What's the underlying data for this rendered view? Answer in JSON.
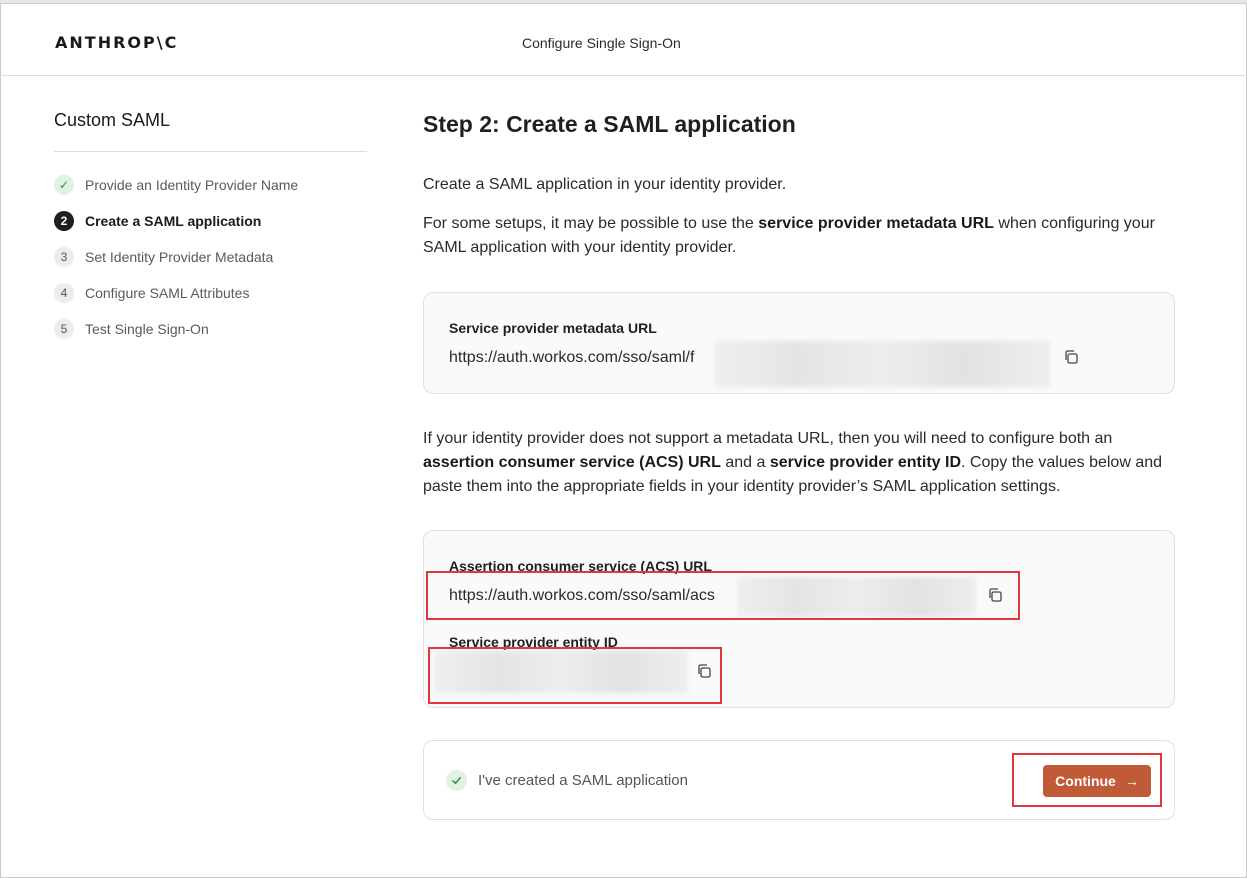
{
  "app": {
    "logo_text": "ANTHROP\\C",
    "header_title": "Configure Single Sign-On"
  },
  "sidebar": {
    "title": "Custom SAML",
    "steps": [
      {
        "badge": "✓",
        "label": "Provide an Identity Provider Name",
        "state": "done"
      },
      {
        "badge": "2",
        "label": "Create a SAML application",
        "state": "active"
      },
      {
        "badge": "3",
        "label": "Set Identity Provider Metadata",
        "state": "todo"
      },
      {
        "badge": "4",
        "label": "Configure SAML Attributes",
        "state": "todo"
      },
      {
        "badge": "5",
        "label": "Test Single Sign-On",
        "state": "todo"
      }
    ]
  },
  "main": {
    "title": "Step 2: Create a SAML application",
    "intro": "Create a SAML application in your identity provider.",
    "metadata_note": {
      "before": "For some setups, it may be possible to use the ",
      "bold": "service provider metadata URL",
      "after": " when configuring your SAML application with your identity provider."
    },
    "metadata_card": {
      "label": "Service provider metadata URL",
      "value": "https://auth.workos.com/sso/saml/f"
    },
    "acs_note": {
      "part1": "If your identity provider does not support a metadata URL, then you will need to configure both an ",
      "bold1": "assertion consumer service (ACS) URL",
      "part2": " and a ",
      "bold2": "service provider entity ID",
      "part3": ". Copy the values below and paste them into the appropriate fields in your identity provider’s SAML application settings."
    },
    "acs_card": {
      "acs_label": "Assertion consumer service (ACS) URL",
      "acs_value": "https://auth.workos.com/sso/saml/acs",
      "entity_label": "Service provider entity ID",
      "entity_value": ""
    },
    "confirm": {
      "label": "I've created a SAML application",
      "checked": true,
      "continue_label": "Continue",
      "continue_arrow": "→"
    }
  },
  "colors": {
    "accent": "#c15a36",
    "highlight": "#e0383e",
    "done_badge_bg": "#dff2e3",
    "done_badge_fg": "#3a8a4d"
  },
  "icons": {
    "copy": "copy-icon",
    "check": "check-icon",
    "arrow": "arrow-right-icon"
  }
}
